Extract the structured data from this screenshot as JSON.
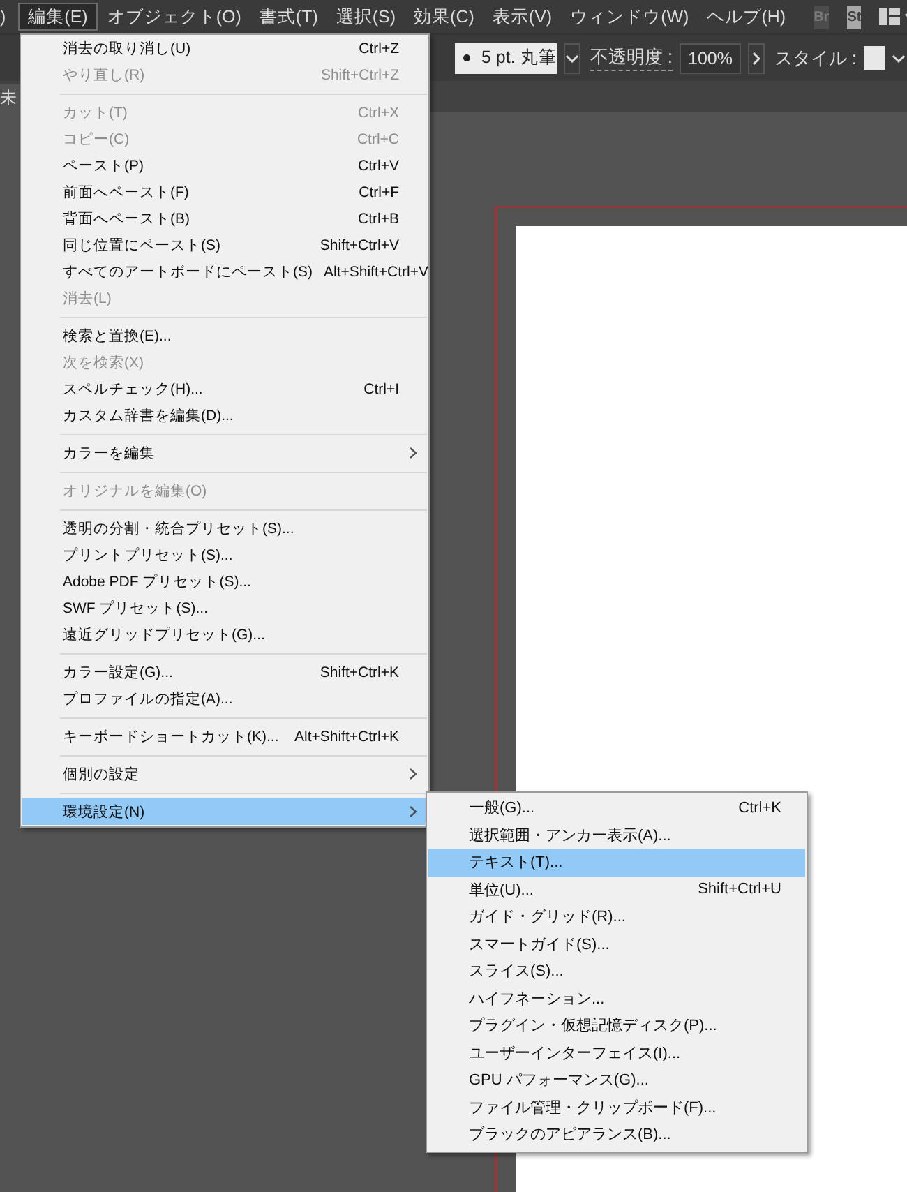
{
  "menu_bar": {
    "items": [
      {
        "label": ")",
        "selected": false
      },
      {
        "label": "編集(E)",
        "selected": true
      },
      {
        "label": "オブジェクト(O)",
        "selected": false
      },
      {
        "label": "書式(T)",
        "selected": false
      },
      {
        "label": "選択(S)",
        "selected": false
      },
      {
        "label": "効果(C)",
        "selected": false
      },
      {
        "label": "表示(V)",
        "selected": false
      },
      {
        "label": "ウィンドウ(W)",
        "selected": false
      },
      {
        "label": "ヘルプ(H)",
        "selected": false
      }
    ],
    "app_buttons": [
      {
        "label": "Br",
        "kind": "dim"
      },
      {
        "label": "St",
        "kind": "light"
      }
    ]
  },
  "control_bar": {
    "brush": "5 pt. 丸筆",
    "opacity_label": "不透明度 :",
    "opacity": "100%",
    "style_label": "スタイル :"
  },
  "document_tab": {
    "title": "未"
  },
  "edit_menu": {
    "items": [
      {
        "kind": "item",
        "label": "消去の取り消し(U)",
        "shortcut": "Ctrl+Z",
        "disabled": false,
        "selected": false
      },
      {
        "kind": "item",
        "label": "やり直し(R)",
        "shortcut": "Shift+Ctrl+Z",
        "disabled": true,
        "selected": false
      },
      {
        "kind": "separator"
      },
      {
        "kind": "item",
        "label": "カット(T)",
        "shortcut": "Ctrl+X",
        "disabled": true,
        "selected": false
      },
      {
        "kind": "item",
        "label": "コピー(C)",
        "shortcut": "Ctrl+C",
        "disabled": true,
        "selected": false
      },
      {
        "kind": "item",
        "label": "ペースト(P)",
        "shortcut": "Ctrl+V",
        "disabled": false,
        "selected": false
      },
      {
        "kind": "item",
        "label": "前面へペースト(F)",
        "shortcut": "Ctrl+F",
        "disabled": false,
        "selected": false
      },
      {
        "kind": "item",
        "label": "背面へペースト(B)",
        "shortcut": "Ctrl+B",
        "disabled": false,
        "selected": false
      },
      {
        "kind": "item",
        "label": "同じ位置にペースト(S)",
        "shortcut": "Shift+Ctrl+V",
        "disabled": false,
        "selected": false
      },
      {
        "kind": "item",
        "label": "すべてのアートボードにペースト(S)",
        "shortcut": "Alt+Shift+Ctrl+V",
        "disabled": false,
        "selected": false
      },
      {
        "kind": "item",
        "label": "消去(L)",
        "disabled": true,
        "selected": false
      },
      {
        "kind": "separator"
      },
      {
        "kind": "item",
        "label": "検索と置換(E)...",
        "disabled": false,
        "selected": false
      },
      {
        "kind": "item",
        "label": "次を検索(X)",
        "disabled": true,
        "selected": false
      },
      {
        "kind": "item",
        "label": "スペルチェック(H)...",
        "shortcut": "Ctrl+I",
        "disabled": false,
        "selected": false
      },
      {
        "kind": "item",
        "label": "カスタム辞書を編集(D)...",
        "disabled": false,
        "selected": false
      },
      {
        "kind": "separator"
      },
      {
        "kind": "submenu",
        "label": "カラーを編集",
        "disabled": false,
        "selected": false
      },
      {
        "kind": "separator"
      },
      {
        "kind": "item",
        "label": "オリジナルを編集(O)",
        "disabled": true,
        "selected": false
      },
      {
        "kind": "separator"
      },
      {
        "kind": "item",
        "label": "透明の分割・統合プリセット(S)...",
        "disabled": false,
        "selected": false
      },
      {
        "kind": "item",
        "label": "プリントプリセット(S)...",
        "disabled": false,
        "selected": false
      },
      {
        "kind": "item",
        "label": "Adobe PDF プリセット(S)...",
        "disabled": false,
        "selected": false
      },
      {
        "kind": "item",
        "label": "SWF プリセット(S)...",
        "disabled": false,
        "selected": false
      },
      {
        "kind": "item",
        "label": "遠近グリッドプリセット(G)...",
        "disabled": false,
        "selected": false
      },
      {
        "kind": "separator"
      },
      {
        "kind": "item",
        "label": "カラー設定(G)...",
        "shortcut": "Shift+Ctrl+K",
        "disabled": false,
        "selected": false
      },
      {
        "kind": "item",
        "label": "プロファイルの指定(A)...",
        "disabled": false,
        "selected": false
      },
      {
        "kind": "separator"
      },
      {
        "kind": "item",
        "label": "キーボードショートカット(K)...",
        "shortcut": "Alt+Shift+Ctrl+K",
        "disabled": false,
        "selected": false
      },
      {
        "kind": "separator"
      },
      {
        "kind": "submenu",
        "label": "個別の設定",
        "disabled": false,
        "selected": false
      },
      {
        "kind": "separator"
      },
      {
        "kind": "submenu",
        "label": "環境設定(N)",
        "disabled": false,
        "selected": true
      }
    ]
  },
  "preferences_submenu": {
    "items": [
      {
        "label": "一般(G)...",
        "shortcut": "Ctrl+K",
        "selected": false
      },
      {
        "label": "選択範囲・アンカー表示(A)...",
        "selected": false
      },
      {
        "label": "テキスト(T)...",
        "selected": true
      },
      {
        "label": "単位(U)...",
        "shortcut": "Shift+Ctrl+U",
        "selected": false
      },
      {
        "label": "ガイド・グリッド(R)...",
        "selected": false
      },
      {
        "label": "スマートガイド(S)...",
        "selected": false
      },
      {
        "label": "スライス(S)...",
        "selected": false
      },
      {
        "label": "ハイフネーション...",
        "selected": false
      },
      {
        "label": "プラグイン・仮想記憶ディスク(P)...",
        "selected": false
      },
      {
        "label": "ユーザーインターフェイス(I)...",
        "selected": false
      },
      {
        "label": "GPU パフォーマンス(G)...",
        "selected": false
      },
      {
        "label": "ファイル管理・クリップボード(F)...",
        "selected": false
      },
      {
        "label": "ブラックのアピアランス(B)...",
        "selected": false
      }
    ]
  }
}
